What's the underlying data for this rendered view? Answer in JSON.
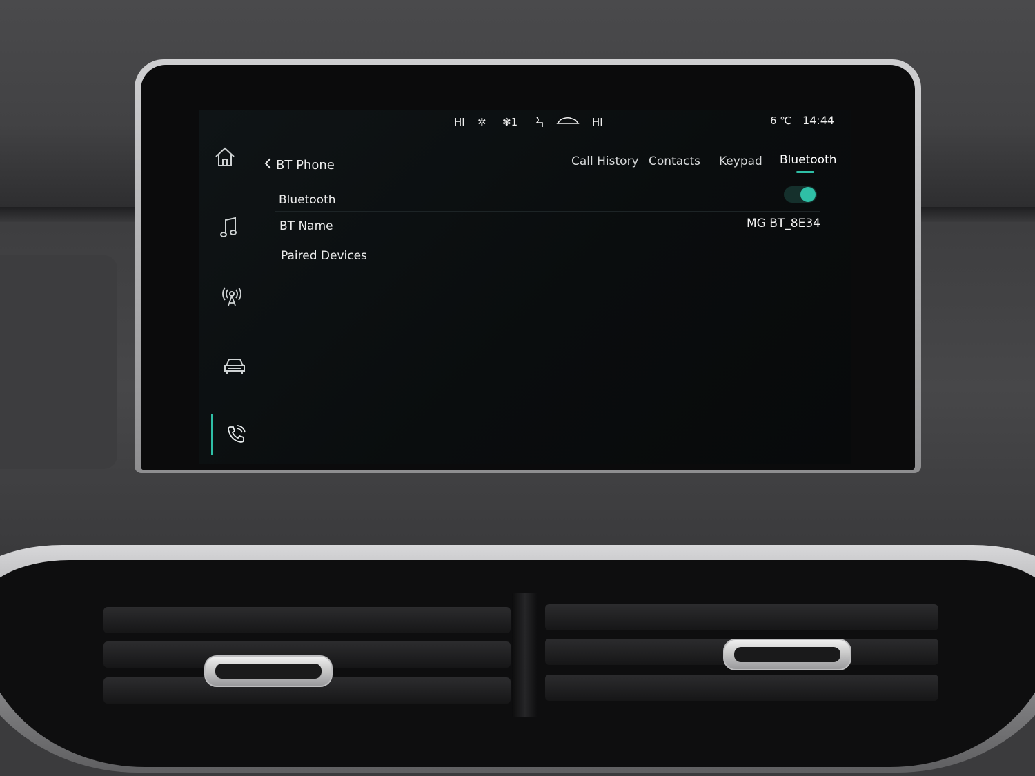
{
  "status_bar": {
    "fan_left": "HI",
    "fan_right": "HI",
    "fan_speed": "1",
    "temperature": "6 ℃",
    "time": "14:44"
  },
  "sidebar": {
    "items": [
      {
        "icon": "home-icon"
      },
      {
        "icon": "music-icon"
      },
      {
        "icon": "radio-icon"
      },
      {
        "icon": "car-icon"
      },
      {
        "icon": "phone-icon",
        "active": true
      }
    ]
  },
  "header": {
    "back_label": "BT Phone",
    "tabs": [
      {
        "label": "Call History"
      },
      {
        "label": "Contacts"
      },
      {
        "label": "Keypad"
      },
      {
        "label": "Bluetooth",
        "active": true
      }
    ]
  },
  "settings": {
    "bluetooth_label": "Bluetooth",
    "bluetooth_enabled": true,
    "bt_name_label": "BT Name",
    "bt_name_value": "MG BT_8E34",
    "paired_devices_label": "Paired Devices"
  },
  "colors": {
    "accent": "#2fbfa6",
    "screen_bg": "#0a0d0e"
  }
}
